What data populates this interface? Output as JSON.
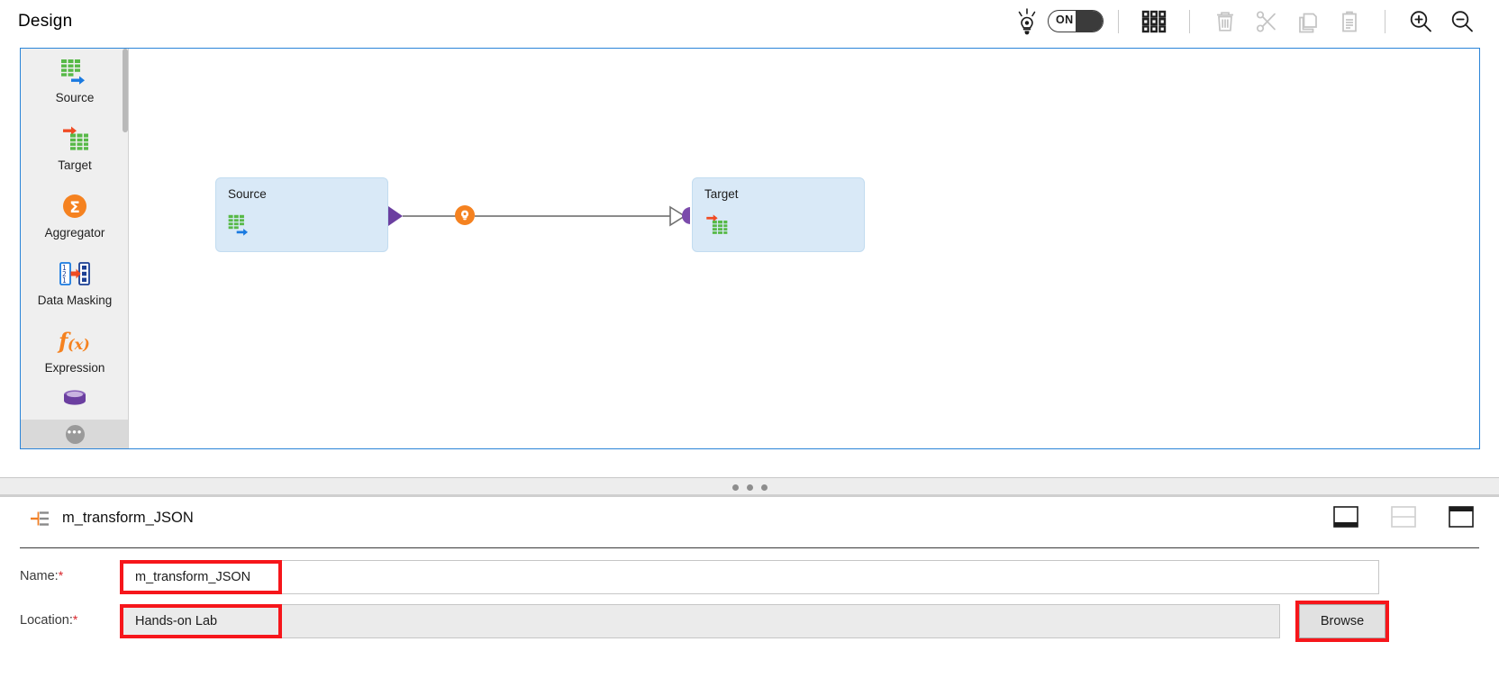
{
  "header": {
    "title": "Design",
    "toolbar": {
      "bulb_icon": "lightbulb-icon",
      "toggle_label": "ON",
      "toggle_state": "on",
      "grid_icon": "grid-icon",
      "delete_icon": "trash-icon",
      "cut_icon": "scissors-icon",
      "copy_icon": "copy-icon",
      "paste_icon": "paste-icon",
      "zoom_in_icon": "zoom-in-icon",
      "zoom_out_icon": "zoom-out-icon"
    }
  },
  "palette": {
    "items": [
      {
        "label": "Source",
        "icon": "table-arrow-out-icon"
      },
      {
        "label": "Target",
        "icon": "arrow-in-table-icon"
      },
      {
        "label": "Aggregator",
        "icon": "sigma-circle-icon"
      },
      {
        "label": "Data Masking",
        "icon": "data-masking-icon"
      },
      {
        "label": "Expression",
        "icon": "function-fx-icon"
      },
      {
        "label": "",
        "icon": "cylinder-icon"
      }
    ],
    "more_label": "•••"
  },
  "canvas": {
    "nodes": [
      {
        "title": "Source",
        "icon": "table-arrow-out-icon"
      },
      {
        "title": "Target",
        "icon": "arrow-in-table-icon"
      }
    ],
    "link": {
      "badge_icon": "lightbulb-icon"
    }
  },
  "properties": {
    "title": "m_transform_JSON",
    "title_icon": "mapping-icon",
    "layout_buttons": [
      {
        "name": "dock-bottom",
        "state": "active"
      },
      {
        "name": "split-horizontal",
        "state": "disabled"
      },
      {
        "name": "dock-top",
        "state": "active"
      }
    ],
    "fields": [
      {
        "label": "Name:",
        "required": "*",
        "value": "m_transform_JSON",
        "highlighted": true,
        "readonly": false
      },
      {
        "label": "Location:",
        "required": "*",
        "value": "Hands-on Lab",
        "highlighted": true,
        "readonly": true
      }
    ],
    "browse_label": "Browse"
  },
  "colors": {
    "accent_blue": "#2a84d8",
    "node_fill": "#d9e9f7",
    "port_purple": "#6b3fa0",
    "badge_orange": "#f58220",
    "highlight_red": "#f6161b",
    "panel_gray": "#efefef"
  }
}
